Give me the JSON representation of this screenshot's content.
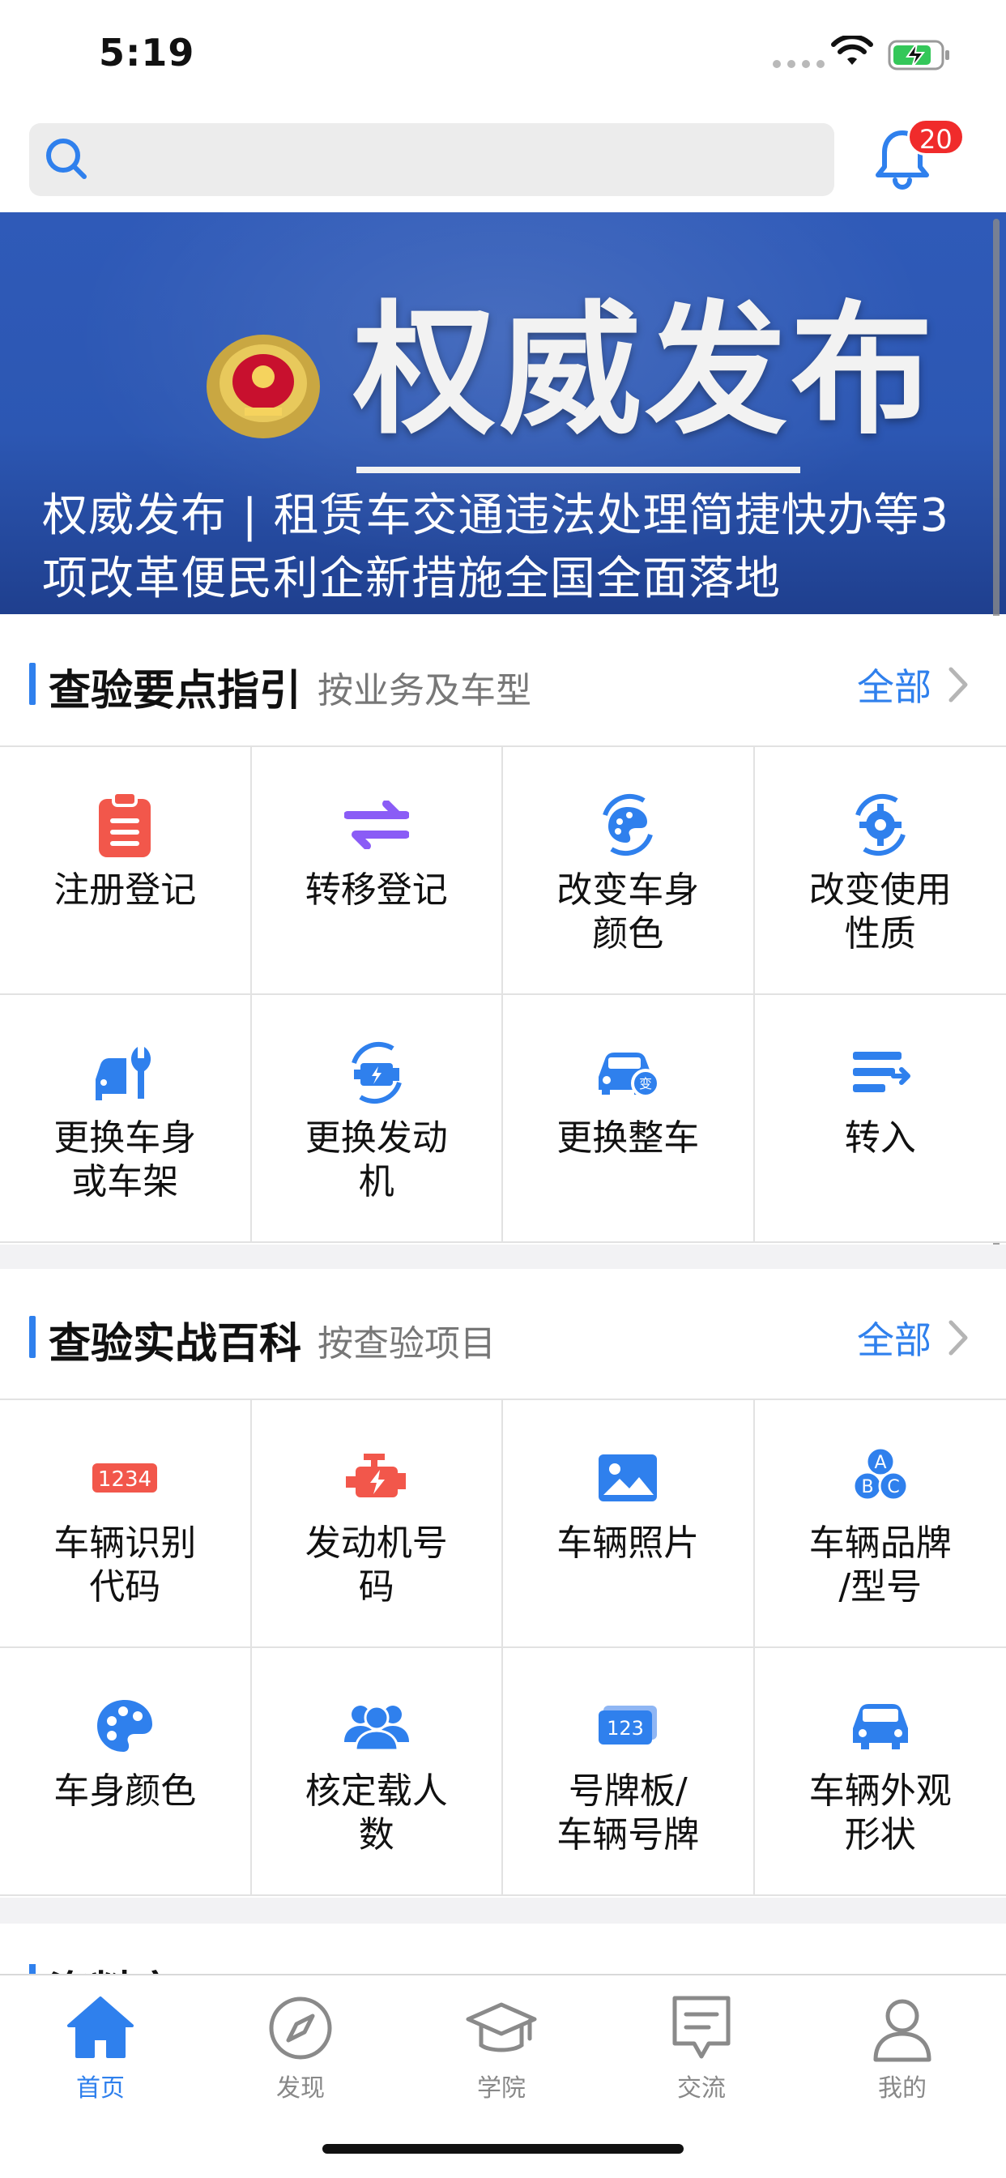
{
  "status_bar": {
    "time": "5:19"
  },
  "header": {
    "search_placeholder": "",
    "notification_count": "20"
  },
  "banner": {
    "title": "权威发布",
    "caption": "权威发布 | 租赁车交通违法处理简捷快办等3项改革便民利企新措施全国全面落地",
    "slide_count": 3,
    "active_slide": 1
  },
  "section1": {
    "title": "查验要点指引",
    "subtitle": "按业务及车型",
    "more": "全部",
    "items": [
      {
        "label": "注册登记",
        "icon": "clipboard-icon"
      },
      {
        "label": "转移登记",
        "icon": "transfer-arrows-icon"
      },
      {
        "label": "改变车身\n颜色",
        "icon": "palette-refresh-icon"
      },
      {
        "label": "改变使用\n性质",
        "icon": "gear-refresh-icon"
      },
      {
        "label": "更换车身\n或车架",
        "icon": "car-wrench-icon"
      },
      {
        "label": "更换发动\n机",
        "icon": "engine-refresh-icon"
      },
      {
        "label": "更换整车",
        "icon": "car-change-icon"
      },
      {
        "label": "转入",
        "icon": "transfer-in-icon"
      }
    ]
  },
  "section2": {
    "title": "查验实战百科",
    "subtitle": "按查验项目",
    "more": "全部",
    "items": [
      {
        "label": "车辆识别\n代码",
        "icon": "vin-icon",
        "icon_text": "1234"
      },
      {
        "label": "发动机号\n码",
        "icon": "engine-icon"
      },
      {
        "label": "车辆照片",
        "icon": "photo-icon"
      },
      {
        "label": "车辆品牌\n/型号",
        "icon": "abc-icon",
        "icon_text": "ABC"
      },
      {
        "label": "车身颜色",
        "icon": "palette-icon"
      },
      {
        "label": "核定载人\n数",
        "icon": "people-icon"
      },
      {
        "label": "号牌板/\n车辆号牌",
        "icon": "plate-icon",
        "icon_text": "123"
      },
      {
        "label": "车辆外观\n形状",
        "icon": "car-icon"
      }
    ]
  },
  "section3_peek": {
    "title": "资料库"
  },
  "tabbar": {
    "tabs": [
      {
        "label": "首页",
        "icon": "home-icon",
        "active": true
      },
      {
        "label": "发现",
        "icon": "compass-icon",
        "active": false
      },
      {
        "label": "学院",
        "icon": "graduation-cap-icon",
        "active": false
      },
      {
        "label": "交流",
        "icon": "message-icon",
        "active": false
      },
      {
        "label": "我的",
        "icon": "user-icon",
        "active": false
      }
    ]
  },
  "colors": {
    "accent": "#2f80ed",
    "red": "#f2574b",
    "purple": "#8a5cf6",
    "badge": "#f02b2b"
  }
}
